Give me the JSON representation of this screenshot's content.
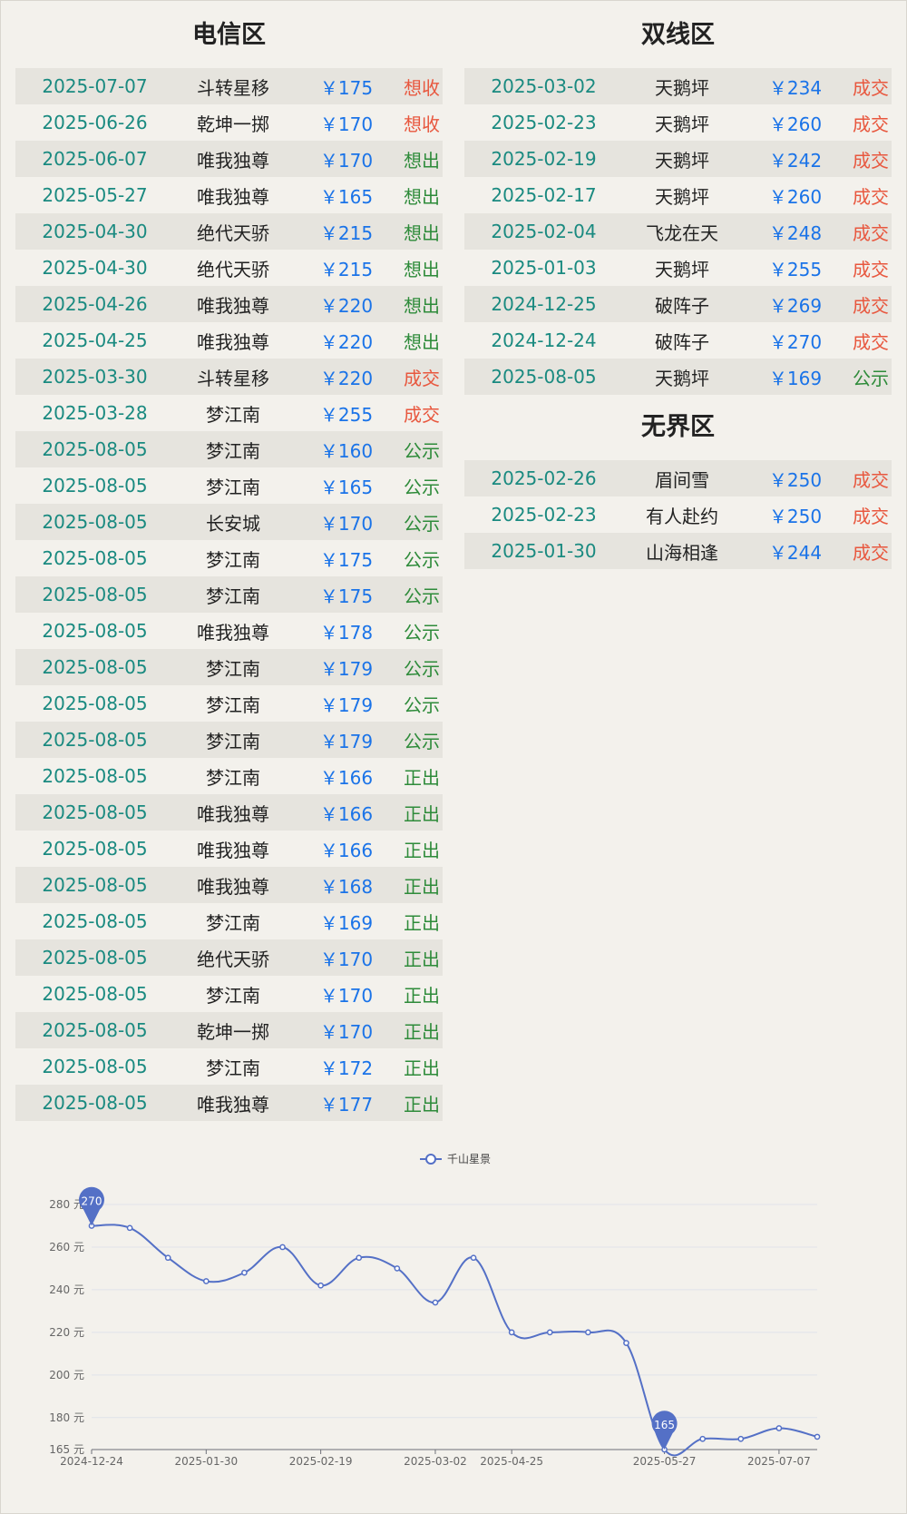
{
  "sections": {
    "dianxin": {
      "title": "电信区",
      "rows": [
        {
          "date": "2025-07-07",
          "name": "斗转星移",
          "price": "￥175",
          "status": "想收",
          "tone": "red"
        },
        {
          "date": "2025-06-26",
          "name": "乾坤一掷",
          "price": "￥170",
          "status": "想收",
          "tone": "red"
        },
        {
          "date": "2025-06-07",
          "name": "唯我独尊",
          "price": "￥170",
          "status": "想出",
          "tone": "green"
        },
        {
          "date": "2025-05-27",
          "name": "唯我独尊",
          "price": "￥165",
          "status": "想出",
          "tone": "green"
        },
        {
          "date": "2025-04-30",
          "name": "绝代天骄",
          "price": "￥215",
          "status": "想出",
          "tone": "green"
        },
        {
          "date": "2025-04-30",
          "name": "绝代天骄",
          "price": "￥215",
          "status": "想出",
          "tone": "green"
        },
        {
          "date": "2025-04-26",
          "name": "唯我独尊",
          "price": "￥220",
          "status": "想出",
          "tone": "green"
        },
        {
          "date": "2025-04-25",
          "name": "唯我独尊",
          "price": "￥220",
          "status": "想出",
          "tone": "green"
        },
        {
          "date": "2025-03-30",
          "name": "斗转星移",
          "price": "￥220",
          "status": "成交",
          "tone": "red"
        },
        {
          "date": "2025-03-28",
          "name": "梦江南",
          "price": "￥255",
          "status": "成交",
          "tone": "red"
        },
        {
          "date": "2025-08-05",
          "name": "梦江南",
          "price": "￥160",
          "status": "公示",
          "tone": "green"
        },
        {
          "date": "2025-08-05",
          "name": "梦江南",
          "price": "￥165",
          "status": "公示",
          "tone": "green"
        },
        {
          "date": "2025-08-05",
          "name": "长安城",
          "price": "￥170",
          "status": "公示",
          "tone": "green"
        },
        {
          "date": "2025-08-05",
          "name": "梦江南",
          "price": "￥175",
          "status": "公示",
          "tone": "green"
        },
        {
          "date": "2025-08-05",
          "name": "梦江南",
          "price": "￥175",
          "status": "公示",
          "tone": "green"
        },
        {
          "date": "2025-08-05",
          "name": "唯我独尊",
          "price": "￥178",
          "status": "公示",
          "tone": "green"
        },
        {
          "date": "2025-08-05",
          "name": "梦江南",
          "price": "￥179",
          "status": "公示",
          "tone": "green"
        },
        {
          "date": "2025-08-05",
          "name": "梦江南",
          "price": "￥179",
          "status": "公示",
          "tone": "green"
        },
        {
          "date": "2025-08-05",
          "name": "梦江南",
          "price": "￥179",
          "status": "公示",
          "tone": "green"
        },
        {
          "date": "2025-08-05",
          "name": "梦江南",
          "price": "￥166",
          "status": "正出",
          "tone": "green"
        },
        {
          "date": "2025-08-05",
          "name": "唯我独尊",
          "price": "￥166",
          "status": "正出",
          "tone": "green"
        },
        {
          "date": "2025-08-05",
          "name": "唯我独尊",
          "price": "￥166",
          "status": "正出",
          "tone": "green"
        },
        {
          "date": "2025-08-05",
          "name": "唯我独尊",
          "price": "￥168",
          "status": "正出",
          "tone": "green"
        },
        {
          "date": "2025-08-05",
          "name": "梦江南",
          "price": "￥169",
          "status": "正出",
          "tone": "green"
        },
        {
          "date": "2025-08-05",
          "name": "绝代天骄",
          "price": "￥170",
          "status": "正出",
          "tone": "green"
        },
        {
          "date": "2025-08-05",
          "name": "梦江南",
          "price": "￥170",
          "status": "正出",
          "tone": "green"
        },
        {
          "date": "2025-08-05",
          "name": "乾坤一掷",
          "price": "￥170",
          "status": "正出",
          "tone": "green"
        },
        {
          "date": "2025-08-05",
          "name": "梦江南",
          "price": "￥172",
          "status": "正出",
          "tone": "green"
        },
        {
          "date": "2025-08-05",
          "name": "唯我独尊",
          "price": "￥177",
          "status": "正出",
          "tone": "green"
        }
      ]
    },
    "shuangxian": {
      "title": "双线区",
      "rows": [
        {
          "date": "2025-03-02",
          "name": "天鹅坪",
          "price": "￥234",
          "status": "成交",
          "tone": "red"
        },
        {
          "date": "2025-02-23",
          "name": "天鹅坪",
          "price": "￥260",
          "status": "成交",
          "tone": "red"
        },
        {
          "date": "2025-02-19",
          "name": "天鹅坪",
          "price": "￥242",
          "status": "成交",
          "tone": "red"
        },
        {
          "date": "2025-02-17",
          "name": "天鹅坪",
          "price": "￥260",
          "status": "成交",
          "tone": "red"
        },
        {
          "date": "2025-02-04",
          "name": "飞龙在天",
          "price": "￥248",
          "status": "成交",
          "tone": "red"
        },
        {
          "date": "2025-01-03",
          "name": "天鹅坪",
          "price": "￥255",
          "status": "成交",
          "tone": "red"
        },
        {
          "date": "2024-12-25",
          "name": "破阵子",
          "price": "￥269",
          "status": "成交",
          "tone": "red"
        },
        {
          "date": "2024-12-24",
          "name": "破阵子",
          "price": "￥270",
          "status": "成交",
          "tone": "red"
        },
        {
          "date": "2025-08-05",
          "name": "天鹅坪",
          "price": "￥169",
          "status": "公示",
          "tone": "green"
        }
      ]
    },
    "wujie": {
      "title": "无界区",
      "rows": [
        {
          "date": "2025-02-26",
          "name": "眉间雪",
          "price": "￥250",
          "status": "成交",
          "tone": "red"
        },
        {
          "date": "2025-02-23",
          "name": "有人赴约",
          "price": "￥250",
          "status": "成交",
          "tone": "red"
        },
        {
          "date": "2025-01-30",
          "name": "山海相逢",
          "price": "￥244",
          "status": "成交",
          "tone": "red"
        }
      ]
    }
  },
  "colors": {
    "date": "#1a8a80",
    "price": "#1a73e8",
    "status_red": "#e8573e",
    "status_green": "#2e8b3a",
    "series": "#5470c6",
    "stripe": "#e6e4de"
  },
  "chart_data": {
    "type": "line",
    "legend": [
      "千山星景"
    ],
    "legend_placement": "top-center",
    "smooth": true,
    "grid": true,
    "y_unit": "元",
    "ylim": [
      165,
      280
    ],
    "y_ticks": [
      "165 元",
      "180 元",
      "200 元",
      "220 元",
      "240 元",
      "260 元",
      "280 元"
    ],
    "x_ticks": [
      "2024-12-24",
      "2025-01-30",
      "2025-02-19",
      "2025-03-02",
      "2025-04-25",
      "2025-05-27",
      "2025-07-07"
    ],
    "series": [
      {
        "name": "千山星景",
        "x": [
          "2024-12-24",
          "2024-12-25",
          "2025-01-03",
          "2025-01-30",
          "2025-02-04",
          "2025-02-17",
          "2025-02-19",
          "2025-02-23",
          "2025-02-26",
          "2025-03-02",
          "2025-03-28",
          "2025-04-25",
          "2025-04-26",
          "2025-04-30",
          "2025-04-30",
          "2025-05-27",
          "2025-06-07",
          "2025-06-26",
          "2025-07-07",
          "2025-08-05"
        ],
        "values": [
          270,
          269,
          255,
          244,
          248,
          260,
          242,
          255,
          250,
          234,
          255,
          220,
          220,
          220,
          215,
          165,
          170,
          170,
          175,
          171
        ]
      }
    ],
    "markers": [
      {
        "label": "270",
        "kind": "max",
        "index": 0
      },
      {
        "label": "165",
        "kind": "min",
        "index": 15
      }
    ]
  }
}
